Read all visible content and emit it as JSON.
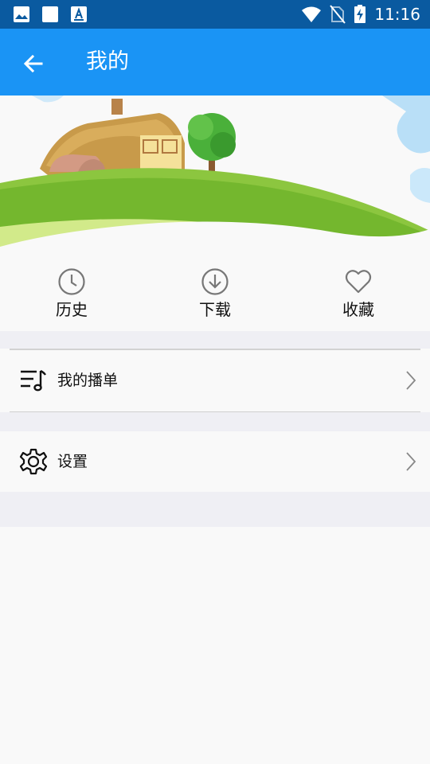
{
  "status_bar": {
    "time": "11:16",
    "left_icons": [
      "image-icon",
      "square-icon",
      "font-icon"
    ],
    "right_icons": [
      "wifi-icon",
      "no-sim-icon",
      "battery-charging-icon"
    ]
  },
  "app_bar": {
    "title": "我的",
    "back_icon": "back-arrow-icon",
    "color": "#1a94f5"
  },
  "quick_actions": [
    {
      "label": "历史",
      "icon": "clock-icon"
    },
    {
      "label": "下载",
      "icon": "download-icon"
    },
    {
      "label": "收藏",
      "icon": "heart-icon"
    }
  ],
  "menu": [
    {
      "label": "我的播单",
      "icon": "playlist-icon"
    },
    {
      "label": "设置",
      "icon": "gear-icon"
    }
  ],
  "colors": {
    "status_bar": "#0a5aa0",
    "accent": "#1a94f5",
    "background": "#f9f9f9",
    "section_gap": "#efeff4"
  }
}
